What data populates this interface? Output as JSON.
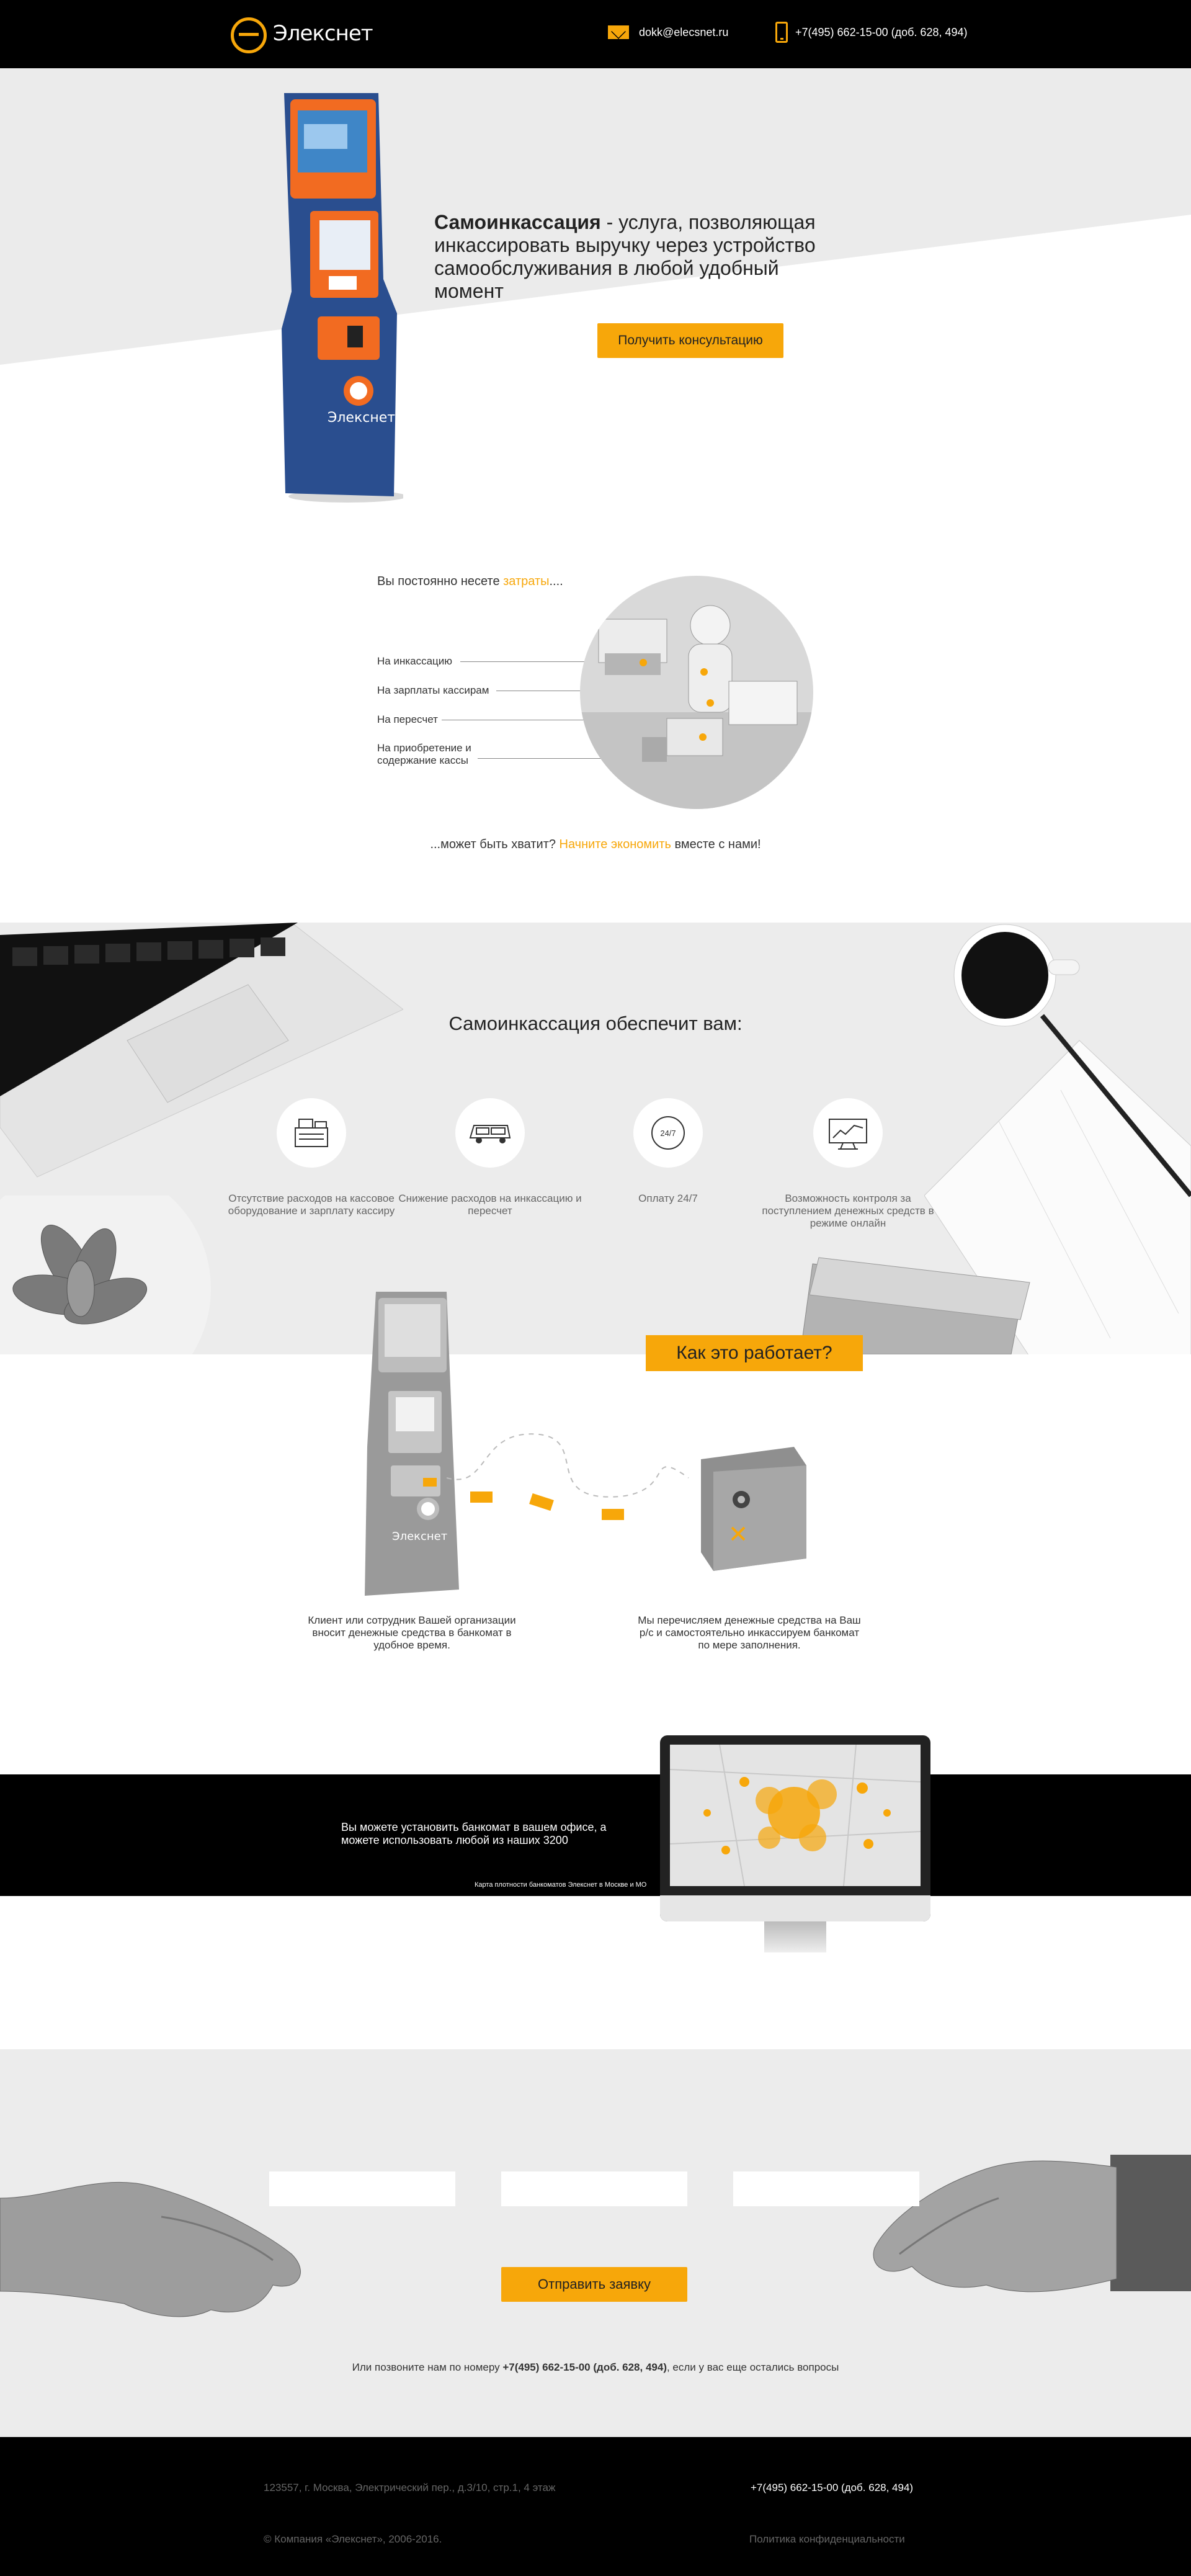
{
  "header": {
    "logo_text": "Элекснет",
    "email": "dokk@elecsnet.ru",
    "phone": "+7(495) 662-15-00 (доб. 628, 494)"
  },
  "hero": {
    "title_bold": "Самоинкассация",
    "title_rest": " - услуга, позволяющая инкассировать выручку через устройство самообслуживания в любой удобный момент",
    "cta_label": "Получить консультацию",
    "kiosk_brand": "Элекснет"
  },
  "costs": {
    "title_prefix": "Вы постоянно несете ",
    "title_highlight": "затраты",
    "title_suffix": "....",
    "items": [
      "На инкассацию",
      "На зарплаты кассирам",
      "На пересчет",
      "На приобретение и содержание кассы"
    ],
    "note_prefix": "...может быть хватит? ",
    "note_highlight": "Начните экономить",
    "note_suffix": " вместе с нами!"
  },
  "provide": {
    "title": "Самоинкассация обеспечит вам:",
    "features": [
      {
        "label": "Отсутствие расходов на кассовое оборудование и зарплату кассиру",
        "icon": "cash-register-icon"
      },
      {
        "label": "Снижение расходов на инкассацию и пересчет",
        "icon": "armored-van-icon"
      },
      {
        "label": "Оплату 24/7",
        "icon": "clock-24-7-icon",
        "icon_text": "24/7"
      },
      {
        "label": "Возможность контроля за поступлением денежных средств в режиме онлайн",
        "icon": "monitor-chart-icon"
      }
    ]
  },
  "how": {
    "button": "Как это работает?",
    "step1": "Клиент или сотрудник Вашей организации вносит денежные средства в банкомат в удобное время.",
    "step2": "Мы перечисляем денежные средства на Ваш р/с и самостоятельно инкассируем банкомат по мере заполнения.",
    "kiosk_brand": "Элекснет"
  },
  "map": {
    "text": "Вы можете установить банкомат в вашем офисе, а можете использовать любой из наших 3200",
    "caption": "Карта плотности банкоматов Элекснет в Москве и МО"
  },
  "form": {
    "submit": "Отправить заявку",
    "call_prefix": "Или позвоните нам по номеру ",
    "call_phone": "+7(495) 662-15-00 (доб. 628, 494)",
    "call_suffix": ", если у вас еще остались вопросы"
  },
  "footer": {
    "address": "123557, г. Москва, Электрический пер., д.3/10, стр.1, 4 этаж",
    "phone": "+7(495) 662-15-00 (доб. 628, 494)",
    "copyright": "© Компания «Элекснет», 2006-2016.",
    "privacy": "Политика конфиденциальности"
  },
  "colors": {
    "accent": "#f7a70a",
    "header_bg": "#000000",
    "section_bg": "#ececec",
    "kiosk_blue": "#2a4e8f",
    "kiosk_orange": "#f26b21"
  }
}
